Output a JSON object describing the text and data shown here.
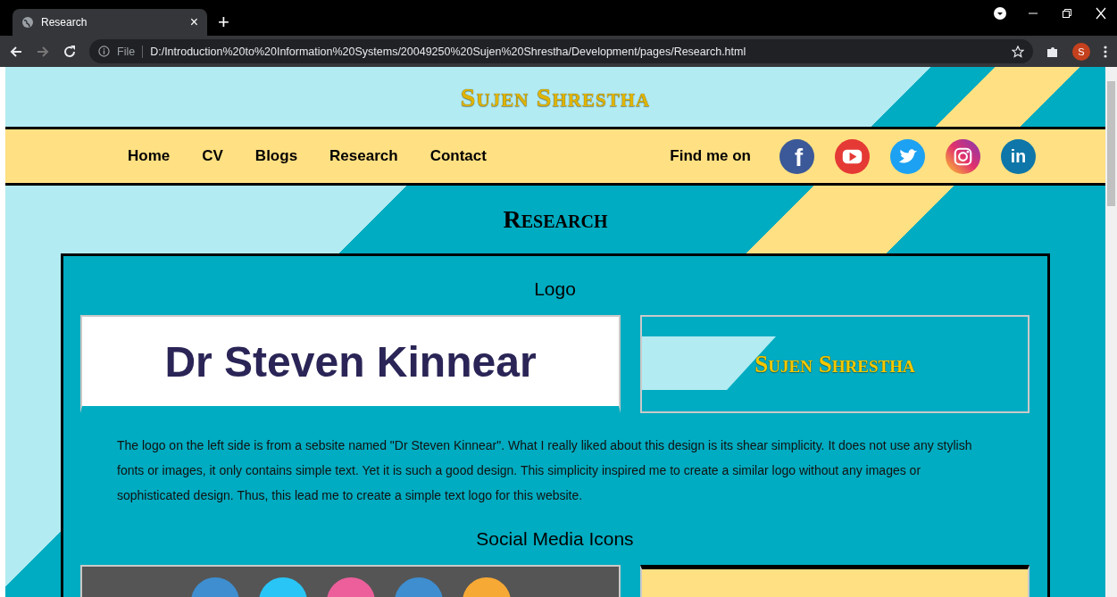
{
  "browser": {
    "tab": {
      "title": "Research",
      "close": "×"
    },
    "new_tab": "+",
    "url_scheme": "File",
    "url": "D:/Introduction%20to%20Information%20Systems/20049250%20Sujen%20Shrestha/Development/pages/Research.html",
    "profile_initial": "S"
  },
  "site": {
    "title": "Sujen Shrestha",
    "nav": [
      {
        "label": "Home"
      },
      {
        "label": "CV"
      },
      {
        "label": "Blogs"
      },
      {
        "label": "Research"
      },
      {
        "label": "Contact"
      }
    ],
    "find_me": "Find me on",
    "socials": [
      {
        "kind": "facebook",
        "glyph": "f"
      },
      {
        "kind": "youtube"
      },
      {
        "kind": "twitter"
      },
      {
        "kind": "instagram"
      },
      {
        "kind": "linkedin",
        "glyph": "in"
      }
    ]
  },
  "page": {
    "heading": "Research",
    "sections": [
      {
        "heading": "Logo",
        "examples": [
          {
            "kind": "text-logo",
            "text": "Dr Steven Kinnear"
          },
          {
            "kind": "site-logo",
            "text": "Sujen Shrestha"
          }
        ],
        "text": "The logo on the left side is from a sebsite named \"Dr Steven Kinnear\". What I really liked about this design is its shear simplicity. It does not use any stylish fonts or images, it only contains simple text. Yet it is such a good design. This simplicity inspired me to create a similar logo without any images or sophisticated design. Thus, this lead me to create a simple text logo for this website."
      },
      {
        "heading": "Social Media Icons",
        "examples": [
          {
            "kind": "dark-icons"
          },
          {
            "kind": "yellow-bar"
          }
        ]
      }
    ]
  }
}
